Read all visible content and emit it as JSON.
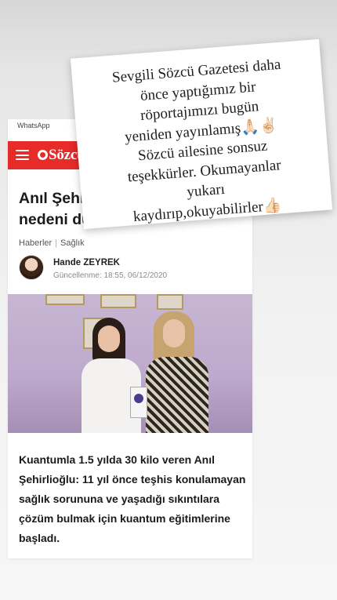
{
  "status_bar": {
    "app_label": "WhatsApp"
  },
  "site": {
    "logo_text": "Sözcü",
    "accent_color": "#e62b29"
  },
  "article": {
    "headline": "Anıl Şehirlioğ\nnedeni duygu",
    "breadcrumb": [
      "Haberler",
      "Sağlık"
    ],
    "author": "Hande ZEYREK",
    "updated": "Güncellenme: 18:55, 06/12/2020",
    "summary": "Kuantumla 1.5 yılda 30 kilo veren Anıl Şehirlioğlu: 11 yıl önce teşhis konulamayan sağlık sorununa ve yaşadığı sıkıntılara çözüm bulmak için kuantum eğitimlerine başladı."
  },
  "note": {
    "text": "Sevgili Sözcü Gazetesi daha\nönce yaptığımız bir\nröportajımızı bugün\nyeniden yayınlamış🙏🏻✌🏻\nSözcü ailesine sonsuz\nteşekkürler. Okumayanlar\nyukarı\nkaydırıp,okuyabilirler👍🏻"
  }
}
